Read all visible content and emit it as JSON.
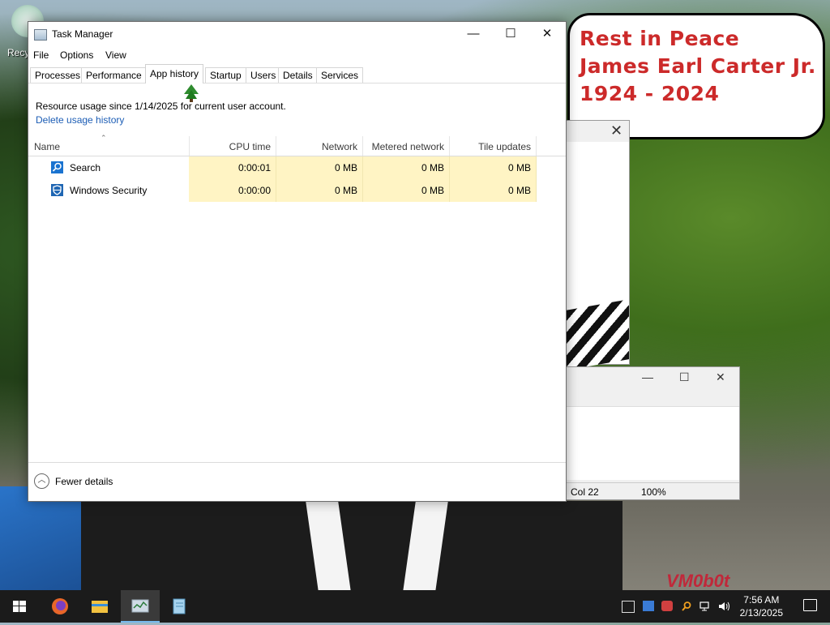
{
  "desktop": {
    "recycle_label": "Recy",
    "bubble_lines": [
      "Rest in Peace",
      "James Earl Carter Jr.",
      "1924 - 2024"
    ],
    "watermark": "VM0b0t",
    "notepad": {
      "status_col": "Col 22",
      "status_zoom": "100%"
    }
  },
  "task_manager": {
    "title": "Task Manager",
    "window_buttons": {
      "minimize": "—",
      "maximize": "☐",
      "close": "✕"
    },
    "menu": [
      "File",
      "Options",
      "View"
    ],
    "tabs": [
      "Processes",
      "Performance",
      "App history",
      "Startup",
      "Users",
      "Details",
      "Services"
    ],
    "active_tab": "App history",
    "usage_text": "Resource usage since 1/14/2025 for current user account.",
    "delete_link": "Delete usage history",
    "columns": [
      "Name",
      "CPU time",
      "Network",
      "Metered network",
      "Tile updates"
    ],
    "rows": [
      {
        "name": "Search",
        "icon": "search-icon",
        "cpu": "0:00:01",
        "network": "0 MB",
        "metered": "0 MB",
        "tile": "0 MB"
      },
      {
        "name": "Windows Security",
        "icon": "shield-icon",
        "cpu": "0:00:00",
        "network": "0 MB",
        "metered": "0 MB",
        "tile": "0 MB"
      }
    ],
    "fewer_details": "Fewer details"
  },
  "taskbar": {
    "time": "7:56 AM",
    "date": "2/13/2025",
    "apps": [
      "start-icon",
      "firefox-icon",
      "file-explorer-icon",
      "task-manager-icon",
      "notepad-icon"
    ],
    "tray": [
      "security-icon",
      "network-adapter-icon",
      "antivirus-icon",
      "search-tray-icon",
      "network-icon",
      "volume-icon"
    ]
  }
}
